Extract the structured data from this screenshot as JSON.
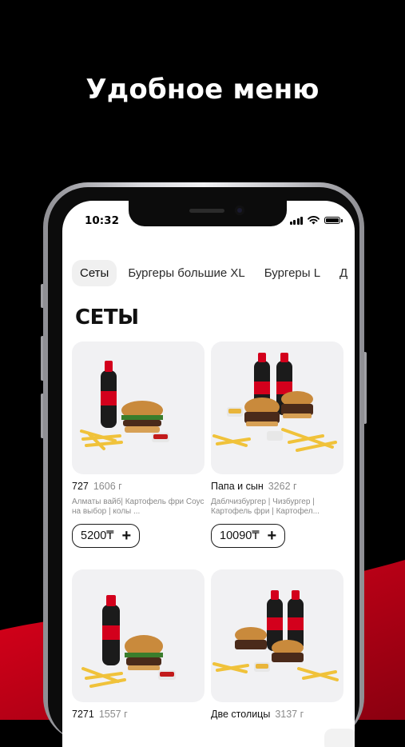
{
  "promo": {
    "headline": "Удобное меню"
  },
  "status_bar": {
    "time": "10:32"
  },
  "tabs": [
    {
      "label": "Сеты",
      "active": true
    },
    {
      "label": "Бургеры большие XL",
      "active": false
    },
    {
      "label": "Бургеры L",
      "active": false
    },
    {
      "label": "Д",
      "active": false
    }
  ],
  "section": {
    "title": "СЕТЫ"
  },
  "products": [
    {
      "name": "727",
      "weight": "1606 г",
      "description": "Алматы вайб| Картофель фри Соус на выбор | колы ...",
      "price": "5200₸",
      "drinks": 1
    },
    {
      "name": "Папа и сын",
      "weight": "3262 г",
      "description": "Даблчизбургер | Чизбургер | Картофель фри | Картофел...",
      "price": "10090₸",
      "drinks": 2
    },
    {
      "name": "7271",
      "weight": "1557 г",
      "description": "",
      "price": "",
      "drinks": 1
    },
    {
      "name": "Две столицы",
      "weight": "3137 г",
      "description": "",
      "price": "",
      "drinks": 2
    }
  ],
  "icons": {
    "add": "plus-icon",
    "signal": "cellular-signal-icon",
    "wifi": "wifi-icon",
    "battery": "battery-icon"
  },
  "colors": {
    "background": "#000000",
    "accent_red": "#d6001c",
    "screen": "#ffffff"
  }
}
